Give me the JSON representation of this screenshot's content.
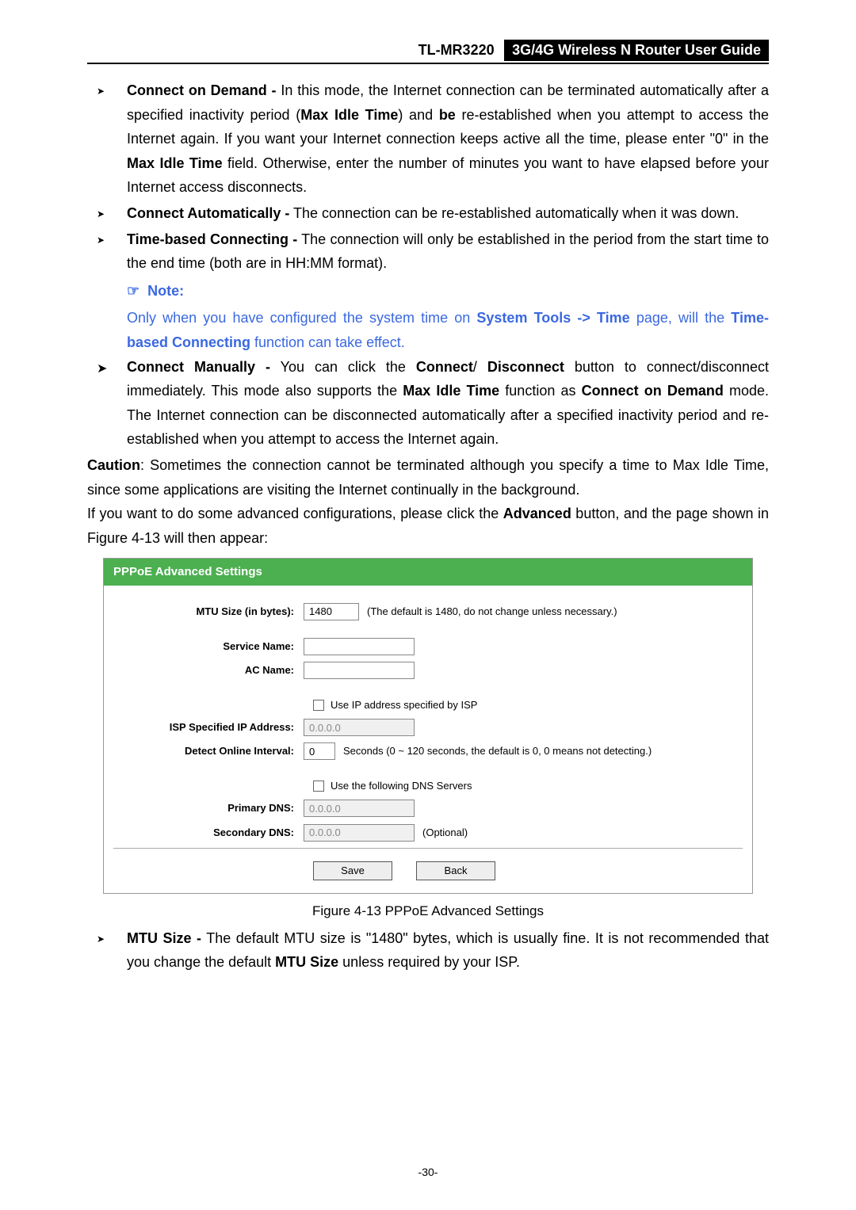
{
  "header": {
    "model": "TL-MR3220",
    "title": "3G/4G Wireless N Router User Guide"
  },
  "bullets1": {
    "b1_label": "Connect on Demand -",
    "b1_text1": " In this mode, the Internet connection can be terminated automatically after a specified inactivity period (",
    "b1_bold1": "Max Idle Time",
    "b1_text2": ") and ",
    "b1_bold2": "be",
    "b1_text3": " re-established when you attempt to access the Internet again. If you want your Internet connection keeps active all the time, please enter \"0\" in the ",
    "b1_bold3": "Max Idle Time",
    "b1_text4": " field. Otherwise, enter the number of minutes you want to have elapsed before your Internet access disconnects.",
    "b2_label": "Connect Automatically -",
    "b2_text": " The connection can be re-established automatically when it was down.",
    "b3_label": "Time-based Connecting -",
    "b3_text": " The connection will only be established in the period from the start time to the end time (both are in HH:MM format)."
  },
  "note": {
    "icon": "☞",
    "label": "Note:",
    "text1": "Only when you have configured the system time on ",
    "bold1": "System Tools -> Time",
    "text2": " page, will the ",
    "bold2": "Time-based Connecting",
    "text3": " function can take effect."
  },
  "bullets2": {
    "b4_label": "Connect Manually -",
    "b4_text1": " You can click the ",
    "b4_bold1": "Connect",
    "b4_sep1": "/ ",
    "b4_bold2": "Disconnect",
    "b4_text2": " button to connect/disconnect immediately. This mode also supports the ",
    "b4_bold3": "Max Idle Time",
    "b4_text3": " function as ",
    "b4_bold4": "Connect on Demand",
    "b4_text4": " mode. The Internet connection can be disconnected automatically after a specified inactivity period and re-established when you attempt to access the Internet again."
  },
  "para1": {
    "bold1": "Caution",
    "text1": ": Sometimes the connection cannot be terminated although you specify a time to Max Idle Time, since some applications are visiting the Internet continually in the background."
  },
  "para2": {
    "text1": "If you want to do some advanced configurations, please click the ",
    "bold1": "Advanced",
    "text2": " button, and the page shown in Figure 4-13 will then appear:"
  },
  "panel": {
    "title": "PPPoE Advanced Settings",
    "mtu_label": "MTU Size (in bytes):",
    "mtu_value": "1480",
    "mtu_hint": "(The default is 1480, do not change unless necessary.)",
    "service_name_label": "Service Name:",
    "service_name_value": "",
    "ac_name_label": "AC Name:",
    "ac_name_value": "",
    "use_ip_label": "Use IP address specified by ISP",
    "isp_ip_label": "ISP Specified IP Address:",
    "isp_ip_value": "0.0.0.0",
    "detect_label": "Detect Online Interval:",
    "detect_value": "0",
    "detect_hint": "Seconds (0 ~ 120 seconds, the default is 0, 0 means not detecting.)",
    "use_dns_label": "Use the following DNS Servers",
    "primary_dns_label": "Primary DNS:",
    "primary_dns_value": "0.0.0.0",
    "secondary_dns_label": "Secondary DNS:",
    "secondary_dns_value": "0.0.0.0",
    "secondary_dns_hint": "(Optional)",
    "save_btn": "Save",
    "back_btn": "Back"
  },
  "figcap": "Figure 4-13    PPPoE Advanced Settings",
  "bullets3": {
    "b5_label": "MTU Size -",
    "b5_text1": " The default MTU size is \"1480\" bytes, which is usually fine. It is not recommended that you change the default ",
    "b5_bold1": "MTU Size",
    "b5_text2": " unless required by your ISP."
  },
  "page_num": "-30-"
}
